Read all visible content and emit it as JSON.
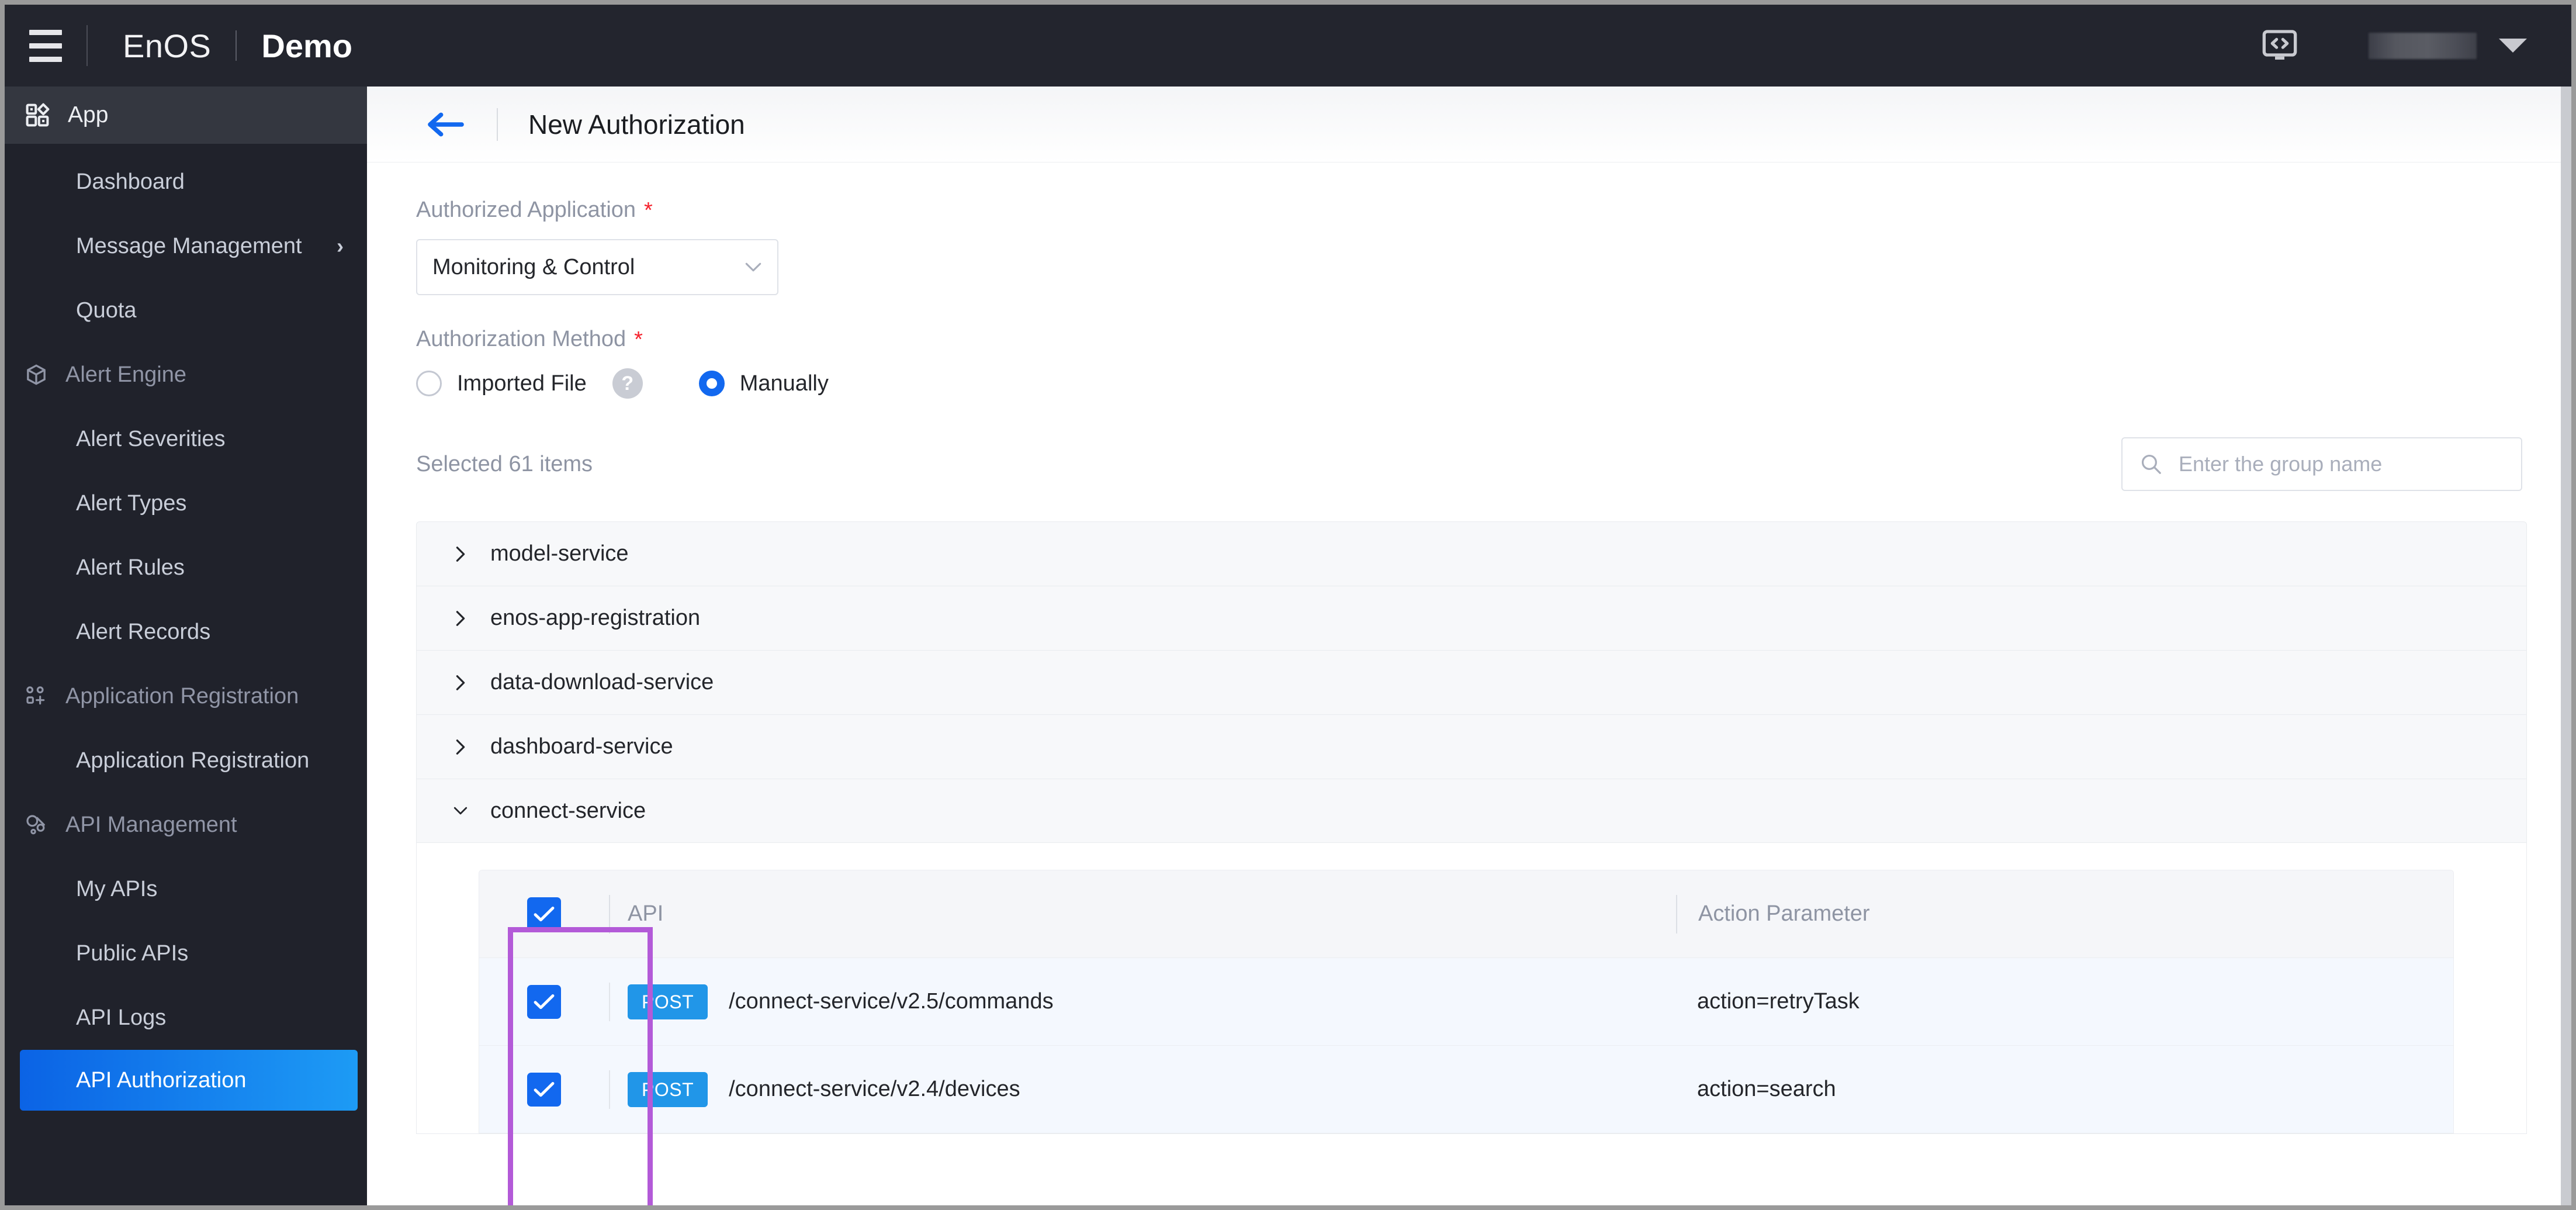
{
  "topbar": {
    "menu_icon": "hamburger-icon",
    "brand": "EnOS",
    "tenant": "Demo",
    "code_icon": "code-screen-icon",
    "user_name": "",
    "caret_icon": "chevron-down-icon"
  },
  "sidebar": {
    "app_header": {
      "icon": "grid-apps-icon",
      "label": "App"
    },
    "items": [
      {
        "label": "Dashboard",
        "type": "item",
        "icon": "",
        "chevron": "",
        "active": false
      },
      {
        "label": "Message Management",
        "type": "item",
        "icon": "",
        "chevron": "›",
        "active": false
      },
      {
        "label": "Quota",
        "type": "item",
        "icon": "",
        "chevron": "",
        "active": false
      },
      {
        "label": "Alert Engine",
        "type": "group",
        "icon": "cube-icon",
        "chevron": "",
        "active": false
      },
      {
        "label": "Alert Severities",
        "type": "item",
        "icon": "",
        "chevron": "",
        "active": false
      },
      {
        "label": "Alert Types",
        "type": "item",
        "icon": "",
        "chevron": "",
        "active": false
      },
      {
        "label": "Alert Rules",
        "type": "item",
        "icon": "",
        "chevron": "",
        "active": false
      },
      {
        "label": "Alert Records",
        "type": "item",
        "icon": "",
        "chevron": "",
        "active": false
      },
      {
        "label": "Application Registration",
        "type": "group",
        "icon": "apps-plus-icon",
        "chevron": "",
        "active": false
      },
      {
        "label": "Application Registration",
        "type": "item",
        "icon": "",
        "chevron": "",
        "active": false
      },
      {
        "label": "API Management",
        "type": "group",
        "icon": "api-link-icon",
        "chevron": "",
        "active": false
      },
      {
        "label": "My APIs",
        "type": "item",
        "icon": "",
        "chevron": "",
        "active": false
      },
      {
        "label": "Public APIs",
        "type": "item",
        "icon": "",
        "chevron": "",
        "active": false
      },
      {
        "label": "API Logs",
        "type": "item",
        "icon": "",
        "chevron": "",
        "active": false
      },
      {
        "label": "API Authorization",
        "type": "item",
        "icon": "",
        "chevron": "",
        "active": true
      }
    ]
  },
  "page": {
    "back_icon": "back-arrow-icon",
    "title": "New Authorization"
  },
  "form": {
    "authorized_application": {
      "label": "Authorized Application",
      "required_marker": "*",
      "value": "Monitoring & Control",
      "caret_icon": "chevron-down-icon"
    },
    "authorization_method": {
      "label": "Authorization Method",
      "required_marker": "*",
      "options": [
        {
          "label": "Imported File",
          "selected": false,
          "help_icon": "question-mark-icon"
        },
        {
          "label": "Manually",
          "selected": true,
          "help_icon": ""
        }
      ]
    }
  },
  "selection": {
    "count_text": "Selected 61 items",
    "search": {
      "icon": "search-icon",
      "placeholder": "Enter the group name",
      "value": ""
    }
  },
  "groups": [
    {
      "name": "model-service",
      "expanded": false,
      "arrow": "chevron-right-icon"
    },
    {
      "name": "enos-app-registration",
      "expanded": false,
      "arrow": "chevron-right-icon"
    },
    {
      "name": "data-download-service",
      "expanded": false,
      "arrow": "chevron-right-icon"
    },
    {
      "name": "dashboard-service",
      "expanded": false,
      "arrow": "chevron-right-icon"
    },
    {
      "name": "connect-service",
      "expanded": true,
      "arrow": "chevron-down-icon"
    }
  ],
  "api_table": {
    "columns": {
      "api": "API",
      "action_parameter": "Action Parameter"
    },
    "header_checked": true,
    "rows": [
      {
        "checked": true,
        "method": "POST",
        "path": "/connect-service/v2.5/commands",
        "action_parameter": "action=retryTask"
      },
      {
        "checked": true,
        "method": "POST",
        "path": "/connect-service/v2.4/devices",
        "action_parameter": "action=search"
      }
    ]
  },
  "annotations": {
    "highlight_color": "#b35ad8",
    "highlight_name": "checkbox-column-highlight"
  },
  "colors": {
    "accent_blue": "#1268ef",
    "method_badge_blue": "#2196e8",
    "sidebar_bg": "#20222b",
    "topbar_bg": "#23252e",
    "required_red": "#f5222d"
  }
}
